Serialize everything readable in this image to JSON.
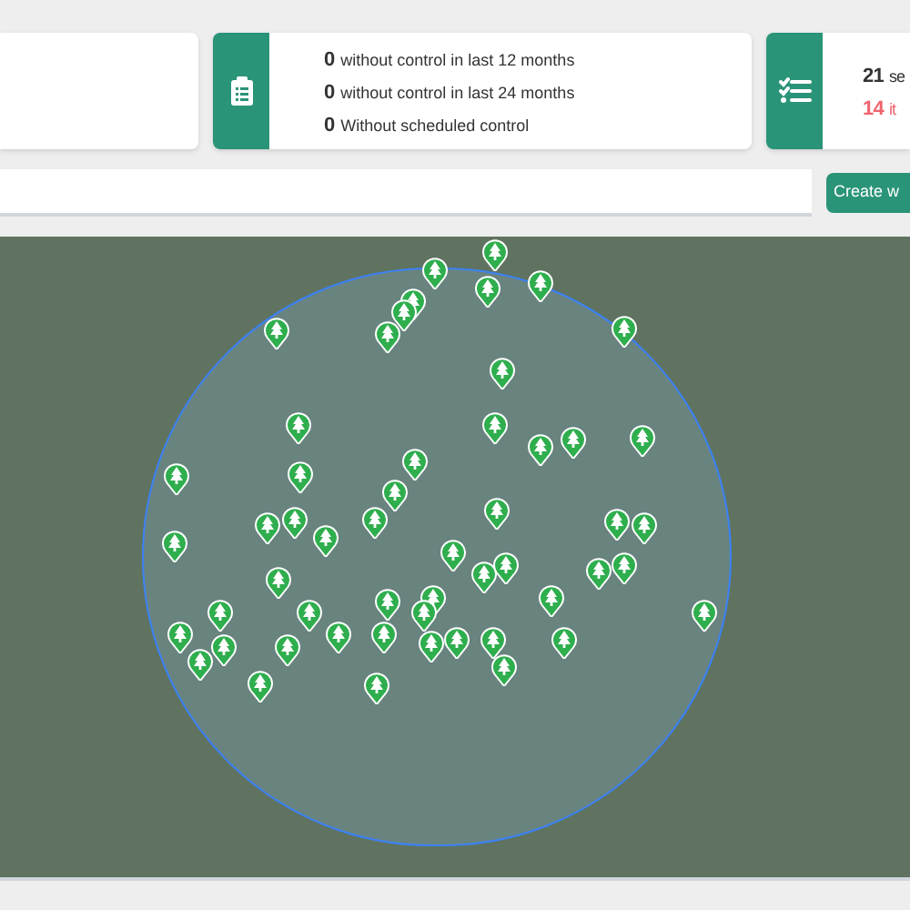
{
  "summary_cards": [
    {
      "stats": [
        {
          "value": "0",
          "label": "without control in last 12 months",
          "kind": "normal"
        },
        {
          "value": "0",
          "label": "without control in last 24 months",
          "kind": "normal"
        },
        {
          "value": "0",
          "label": "Without scheduled control",
          "kind": "normal"
        }
      ]
    },
    {
      "stats": [
        {
          "value": "21",
          "label": "se",
          "kind": "normal"
        },
        {
          "value": "14",
          "label": "it",
          "kind": "warning"
        }
      ]
    }
  ],
  "toolbar": {
    "create_button": "Create w"
  }
}
